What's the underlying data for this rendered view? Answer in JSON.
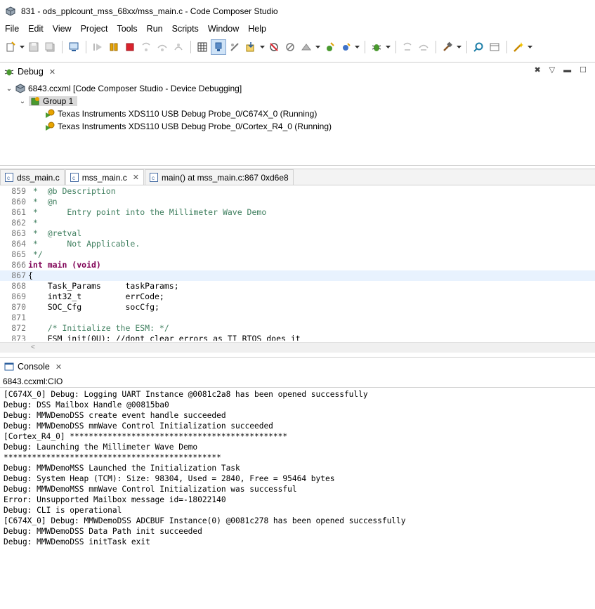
{
  "window": {
    "title": "831 - ods_pplcount_mss_68xx/mss_main.c - Code Composer Studio"
  },
  "menu": [
    "File",
    "Edit",
    "View",
    "Project",
    "Tools",
    "Run",
    "Scripts",
    "Window",
    "Help"
  ],
  "toolbar": {
    "icons": [
      "new-icon",
      "save-icon",
      "save-all-icon",
      "terminal-icon",
      "resume-icon",
      "suspend-icon",
      "terminate-icon",
      "step-into-icon",
      "step-over-icon",
      "step-return-icon",
      "memory-browser-icon",
      "connect-target-icon",
      "disconnect-icon",
      "load-program-icon",
      "restart-icon",
      "reset-icon",
      "breakpoint-icon",
      "debug-icon",
      "build-icon",
      "refresh-icon",
      "search-icon",
      "open-perspective-icon",
      "wand-icon"
    ]
  },
  "debug_view": {
    "tab_label": "Debug",
    "tree": [
      {
        "label": "6843.ccxml [Code Composer Studio - Device Debugging]"
      },
      {
        "label": "Group 1"
      },
      {
        "label": "Texas Instruments XDS110 USB Debug Probe_0/C674X_0 (Running)"
      },
      {
        "label": "Texas Instruments XDS110 USB Debug Probe_0/Cortex_R4_0 (Running)"
      }
    ]
  },
  "editor": {
    "tabs": [
      {
        "label": "dss_main.c"
      },
      {
        "label": "mss_main.c"
      },
      {
        "label": "main() at mss_main.c:867 0xd6e8"
      }
    ],
    "lines": [
      {
        "num": "859",
        "text": " *  @b Description"
      },
      {
        "num": "860",
        "text": " *  @n"
      },
      {
        "num": "861",
        "text": " *      Entry point into the Millimeter Wave Demo"
      },
      {
        "num": "862",
        "text": " *"
      },
      {
        "num": "863",
        "text": " *  @retval"
      },
      {
        "num": "864",
        "text": " *      Not Applicable."
      },
      {
        "num": "865",
        "text": " */"
      },
      {
        "num": "866",
        "text": "int main (void)"
      },
      {
        "num": "867",
        "text": "{"
      },
      {
        "num": "868",
        "text": "    Task_Params     taskParams;"
      },
      {
        "num": "869",
        "text": "    int32_t         errCode;"
      },
      {
        "num": "870",
        "text": "    SOC_Cfg         socCfg;"
      },
      {
        "num": "871",
        "text": ""
      },
      {
        "num": "872",
        "text": "    /* Initialize the ESM: */"
      },
      {
        "num": "873",
        "text": "    ESM_init(0U); //dont clear errors as TI RTOS does it"
      }
    ]
  },
  "console": {
    "tab_label": "Console",
    "subtitle": "6843.ccxml:CIO",
    "lines": [
      "[C674X_0] Debug: Logging UART Instance @0081c2a8 has been opened successfully",
      "Debug: DSS Mailbox Handle @00815ba0",
      "Debug: MMWDemoDSS create event handle succeeded",
      "Debug: MMWDemoDSS mmWave Control Initialization succeeded",
      "[Cortex_R4_0] **********************************************",
      "Debug: Launching the Millimeter Wave Demo",
      "**********************************************",
      "Debug: MMWDemoMSS Launched the Initialization Task",
      "Debug: System Heap (TCM): Size: 98304, Used = 2840, Free = 95464 bytes",
      "Debug: MMWDemoMSS mmWave Control Initialization was successful",
      "Error: Unsupported Mailbox message id=-18022140",
      "Debug: CLI is operational",
      "[C674X_0] Debug: MMWDemoDSS ADCBUF Instance(0) @0081c278 has been opened successfully",
      "Debug: MMWDemoDSS Data Path init succeeded",
      "Debug: MMWDemoDSS initTask exit"
    ]
  }
}
